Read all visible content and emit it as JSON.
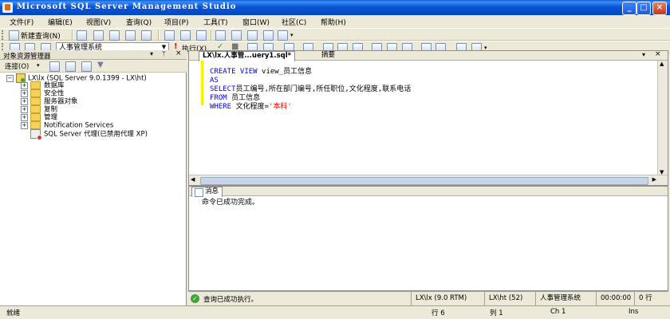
{
  "window": {
    "title": "Microsoft SQL Server Management Studio"
  },
  "menu": [
    "文件(F)",
    "编辑(E)",
    "视图(V)",
    "查询(Q)",
    "项目(P)",
    "工具(T)",
    "窗口(W)",
    "社区(C)",
    "帮助(H)"
  ],
  "toolbar1": {
    "new_query_label": "新建查询(N)"
  },
  "toolbar2": {
    "database_selected": "人事管理系统",
    "execute_label": "执行(X)"
  },
  "object_explorer": {
    "title": "对象资源管理器",
    "connect_label": "连接(O)",
    "server_node": "LX\\lx (SQL Server 9.0.1399 - LX\\ht)",
    "children": [
      "数据库",
      "安全性",
      "服务器对象",
      "复制",
      "管理",
      "Notification Services"
    ],
    "agent_node": "SQL Server 代理(已禁用代理 XP)"
  },
  "editor": {
    "tabs": [
      "LX\\lx.人事管...uery1.sql*",
      "摘要"
    ],
    "code": {
      "l1_kw": "CREATE VIEW",
      "l1_rest": " view_员工信息",
      "l2_kw": "AS",
      "l3_kw": "SELECT",
      "l3_rest": "员工编号,所在部门编号,所任职位,文化程度,联系电话",
      "l4_kw": "FROM",
      "l4_rest": " 员工信息",
      "l5_kw": "WHERE",
      "l5_rest": " 文化程度=",
      "l5_str": "'本科'"
    }
  },
  "results": {
    "tab_label": "消息",
    "message": "命令已成功完成。"
  },
  "query_status": {
    "message": "查询已成功执行。",
    "server": "LX\\lx (9.0 RTM)",
    "login": "LX\\ht (52)",
    "database": "人事管理系统",
    "elapsed": "00:00:00",
    "rows": "0 行"
  },
  "status": {
    "ready": "就绪",
    "line": "行 6",
    "col": "列 1",
    "ch": "Ch 1",
    "ins": "Ins"
  }
}
